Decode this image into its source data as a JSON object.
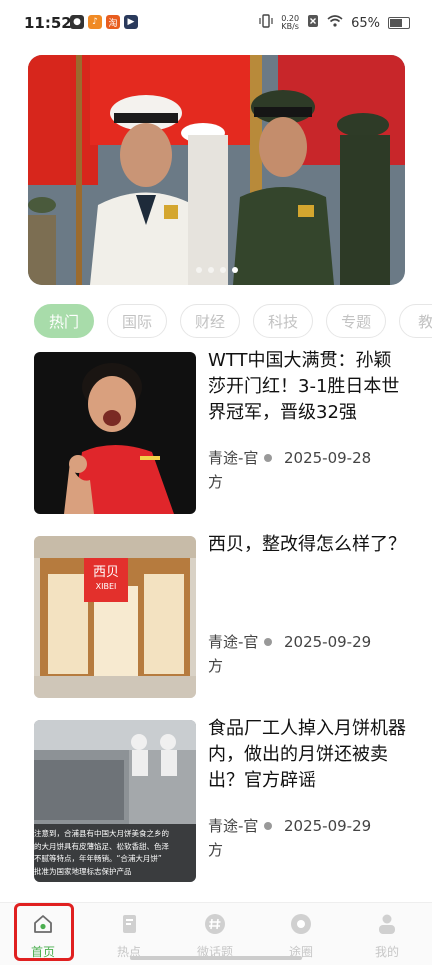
{
  "status_bar": {
    "time": "11:52",
    "net_speed_value": "0.20",
    "net_speed_unit": "KB/s",
    "battery": "65%",
    "battery_level": 0.65
  },
  "banner": {
    "slide_count": 4,
    "active_slide": 3
  },
  "tabs": [
    {
      "label": "热门",
      "active": true
    },
    {
      "label": "国际",
      "active": false
    },
    {
      "label": "财经",
      "active": false
    },
    {
      "label": "科技",
      "active": false
    },
    {
      "label": "专题",
      "active": false
    },
    {
      "label": "教",
      "active": false
    }
  ],
  "articles": [
    {
      "title": "WTT中国大满贯：孙颖莎开门红！3-1胜日本世界冠军，晋级32强",
      "source": "青途-官方",
      "date": "2025-09-28"
    },
    {
      "title": "西贝，整改得怎么样了？",
      "source": "青途-官方",
      "date": "2025-09-29",
      "thumb_text_1": "西贝",
      "thumb_text_2": "XIBEI"
    },
    {
      "title": "食品厂工人掉入月饼机器内，做出的月饼还被卖出？官方辟谣",
      "source": "青途-官方",
      "date": "2025-09-29",
      "thumb_caption_1": "注意到，合浦县有中国大月饼美食之乡的",
      "thumb_caption_2": "的大月饼具有皮薄馅足、松软香甜、色泽",
      "thumb_caption_3": "不腻等特点，年年畅销。“合浦大月饼”",
      "thumb_caption_4": "批准为国家地理标志保护产品"
    }
  ],
  "bottom_nav": [
    {
      "label": "首页",
      "icon": "home-icon",
      "active": true
    },
    {
      "label": "热点",
      "icon": "document-icon",
      "active": false
    },
    {
      "label": "微话题",
      "icon": "hashtag-icon",
      "active": false
    },
    {
      "label": "途圈",
      "icon": "circle-icon",
      "active": false
    },
    {
      "label": "我的",
      "icon": "user-icon",
      "active": false
    }
  ],
  "colors": {
    "accent": "#4caf50",
    "tab_active_bg": "#a8dcaa",
    "highlight": "#e02020"
  }
}
